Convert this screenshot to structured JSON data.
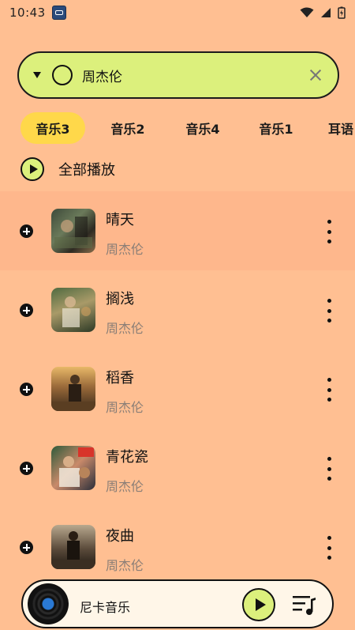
{
  "status_bar": {
    "time": "10:43"
  },
  "search": {
    "value": "周杰伦"
  },
  "tabs": [
    {
      "label": "音乐3",
      "active": true
    },
    {
      "label": "音乐2",
      "active": false
    },
    {
      "label": "音乐4",
      "active": false
    },
    {
      "label": "音乐1",
      "active": false
    },
    {
      "label": "耳语",
      "active": false
    }
  ],
  "play_all": {
    "label": "全部播放"
  },
  "songs": [
    {
      "title": "晴天",
      "artist": "周杰伦"
    },
    {
      "title": "搁浅",
      "artist": "周杰伦"
    },
    {
      "title": "稻香",
      "artist": "周杰伦"
    },
    {
      "title": "青花瓷",
      "artist": "周杰伦"
    },
    {
      "title": "夜曲",
      "artist": "周杰伦"
    }
  ],
  "player": {
    "title": "尼卡音乐"
  },
  "colors": {
    "background": "#FFBF92",
    "accent_green": "#DCF07C",
    "tab_active": "#FFD84A",
    "artist_gray": "#8a7e76"
  }
}
